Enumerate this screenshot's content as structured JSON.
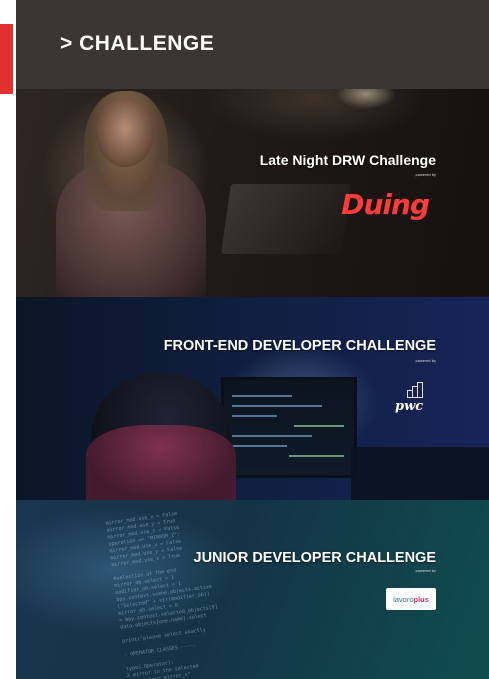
{
  "header": {
    "title": "> CHALLENGE"
  },
  "challenges": [
    {
      "title": "Late Night DRW Challenge",
      "powered_by": "powered by",
      "sponsor": "Duing",
      "sponsor_icon": "duing-logo"
    },
    {
      "title": "FRONT-END DEVELOPER CHALLENGE",
      "powered_by": "powered by",
      "sponsor": "pwc",
      "sponsor_icon": "pwc-logo"
    },
    {
      "title": "JUNIOR DEVELOPER CHALLENGE",
      "powered_by": "powered by",
      "sponsor": "lavoro",
      "sponsor_suffix": "plus",
      "sponsor_icon": "lavoroplus-logo"
    }
  ],
  "colors": {
    "header_bg": "#393633",
    "accent": "#e0312f",
    "duing_red": "#ff3b3b"
  }
}
